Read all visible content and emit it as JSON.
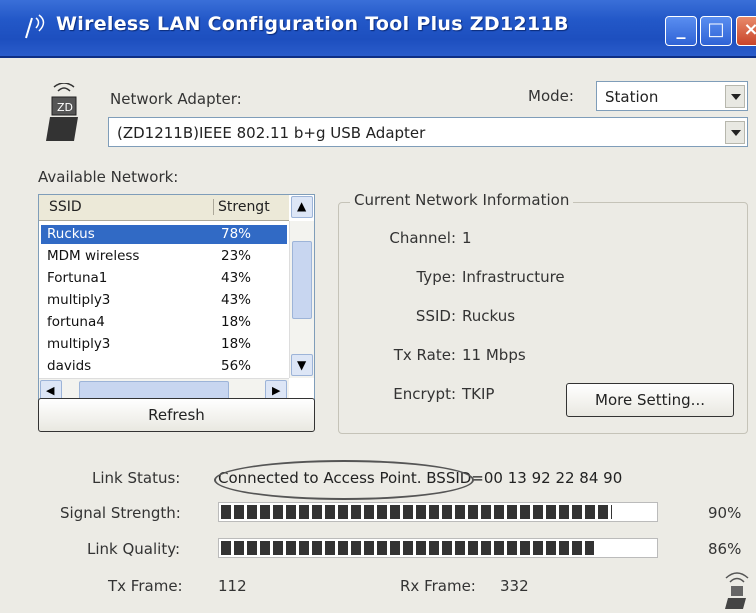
{
  "window": {
    "title": "Wireless LAN Configuration Tool Plus  ZD1211B",
    "controls": [
      "minimize",
      "maximize",
      "close"
    ]
  },
  "adapter": {
    "label": "Network Adapter:",
    "value": "(ZD1211B)IEEE 802.11 b+g USB Adapter",
    "icon": "usb-adapter-icon"
  },
  "mode": {
    "label": "Mode:",
    "value": "Station"
  },
  "available": {
    "label": "Available Network:",
    "columns": [
      "SSID",
      "Strengt"
    ],
    "rows": [
      {
        "ssid": "Ruckus",
        "strength": "78%",
        "selected": true
      },
      {
        "ssid": "MDM wireless",
        "strength": "23%",
        "selected": false
      },
      {
        "ssid": "Fortuna1",
        "strength": "43%",
        "selected": false
      },
      {
        "ssid": "multiply3",
        "strength": "43%",
        "selected": false
      },
      {
        "ssid": "fortuna4",
        "strength": "18%",
        "selected": false
      },
      {
        "ssid": "multiply3",
        "strength": "18%",
        "selected": false
      },
      {
        "ssid": "davids",
        "strength": "56%",
        "selected": false
      }
    ],
    "refresh_label": "Refresh"
  },
  "current": {
    "title": "Current Network Information",
    "channel_label": "Channel:",
    "channel": "1",
    "type_label": "Type:",
    "type": "Infrastructure",
    "ssid_label": "SSID:",
    "ssid": "Ruckus",
    "txrate_label": "Tx Rate:",
    "txrate": "11 Mbps",
    "encrypt_label": "Encrypt:",
    "encrypt": "TKIP",
    "more_label": "More Setting..."
  },
  "status": {
    "link_label": "Link Status:",
    "link_value": "Connected to Access Point. BSSID=00 13 92 22 84 90",
    "signal_label": "Signal Strength:",
    "signal_pct": "90%",
    "signal_fraction": 0.9,
    "quality_label": "Link Quality:",
    "quality_pct": "86%",
    "quality_fraction": 0.86,
    "tx_label": "Tx Frame:",
    "tx": "112",
    "rx_label": "Rx Frame:",
    "rx": "332"
  },
  "colors": {
    "titlebar": "#2358c8",
    "selection": "#316ac5",
    "window": "#ecebe5"
  }
}
